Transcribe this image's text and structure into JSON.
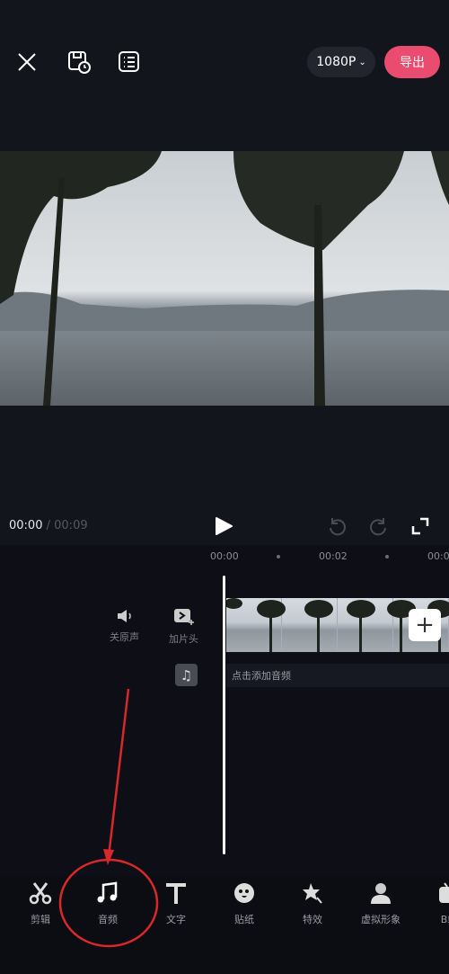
{
  "header": {
    "resolution": "1080P",
    "export_label": "导出"
  },
  "player": {
    "current_time": "00:00",
    "separator": "/",
    "total_time": "00:09"
  },
  "timeline": {
    "ticks": [
      "00:00",
      "00:02",
      "00:0"
    ],
    "mute_label": "关原声",
    "add_intro_label": "加片头",
    "add_audio_hint": "点击添加音频"
  },
  "toolbar": {
    "items": [
      {
        "label": "剪辑",
        "icon": "scissors-icon"
      },
      {
        "label": "音频",
        "icon": "music-note-icon"
      },
      {
        "label": "文字",
        "icon": "text-icon"
      },
      {
        "label": "贴纸",
        "icon": "sticker-icon"
      },
      {
        "label": "特效",
        "icon": "star-effect-icon"
      },
      {
        "label": "虚拟形象",
        "icon": "avatar-icon"
      },
      {
        "label": "B站",
        "icon": "bilibili-icon"
      }
    ]
  },
  "colors": {
    "accent": "#ea4c6f",
    "annotation": "#d8282a",
    "background": "#13151d"
  }
}
